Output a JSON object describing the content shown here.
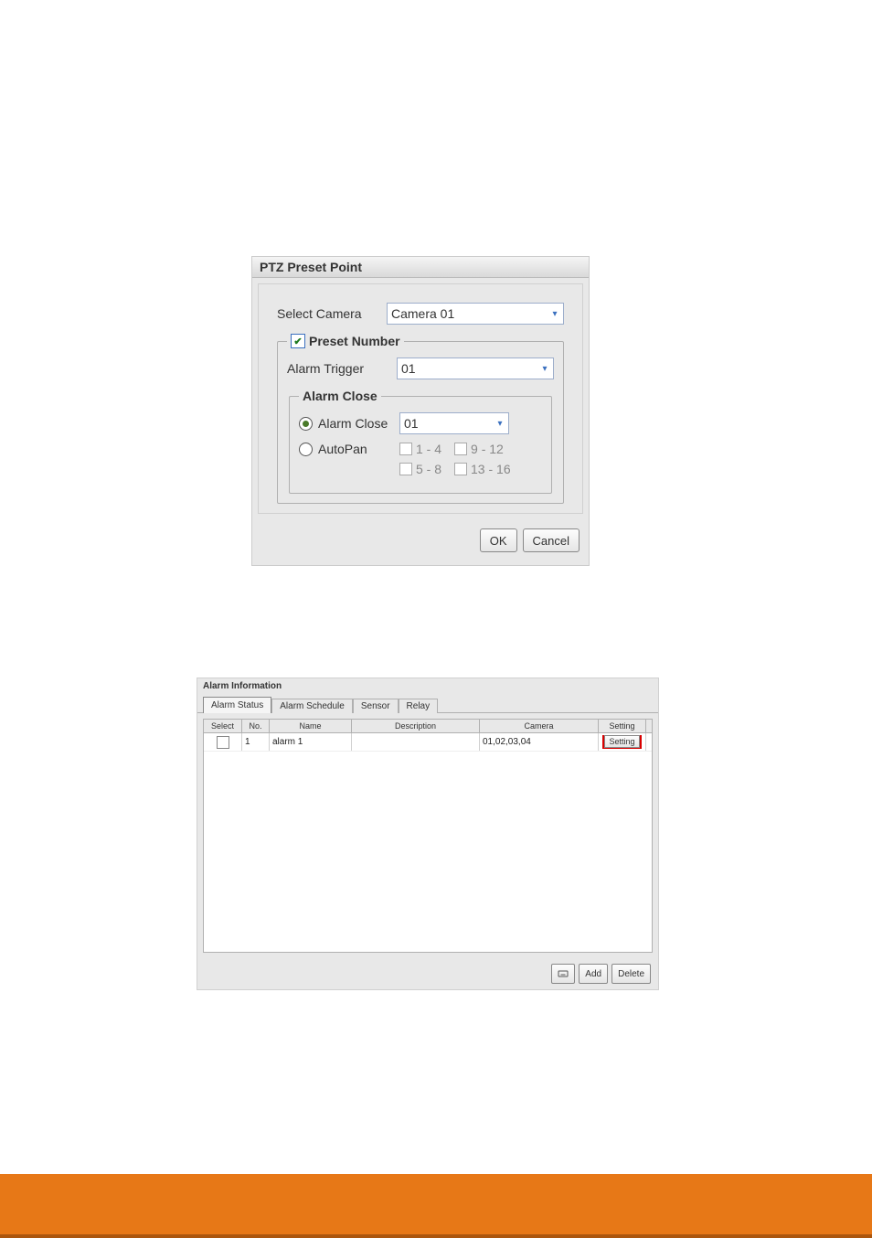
{
  "dialog1": {
    "title": "PTZ Preset Point",
    "select_camera_label": "Select Camera",
    "select_camera_value": "Camera 01",
    "preset_number_legend": "Preset Number",
    "preset_number_checked": true,
    "alarm_trigger_label": "Alarm Trigger",
    "alarm_trigger_value": "01",
    "alarm_close_legend": "Alarm Close",
    "alarm_close_radio_label": "Alarm Close",
    "alarm_close_value": "01",
    "autopan_radio_label": "AutoPan",
    "autopan_ranges": [
      "1 - 4",
      "9 - 12",
      "5 - 8",
      "13 - 16"
    ],
    "ok_label": "OK",
    "cancel_label": "Cancel"
  },
  "dialog2": {
    "title": "Alarm Information",
    "tabs": [
      "Alarm Status",
      "Alarm Schedule",
      "Sensor",
      "Relay"
    ],
    "active_tab_index": 0,
    "columns": [
      "Select",
      "No.",
      "Name",
      "Description",
      "Camera",
      "Setting"
    ],
    "rows": [
      {
        "select": false,
        "no": "1",
        "name": "alarm 1",
        "description": "",
        "camera": "01,02,03,04",
        "setting_label": "Setting"
      }
    ],
    "footer": {
      "icon_tooltip": "edit",
      "add_label": "Add",
      "delete_label": "Delete"
    }
  }
}
